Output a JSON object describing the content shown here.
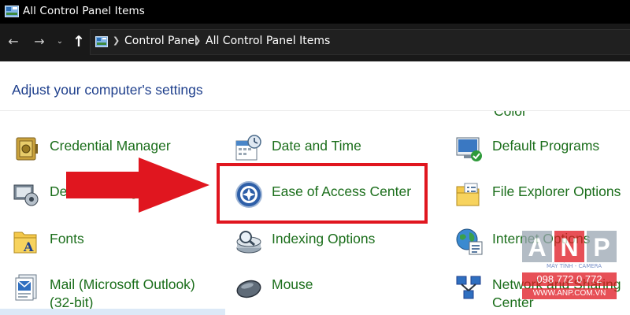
{
  "window": {
    "title": "All Control Panel Items",
    "app_icon": "control-panel-icon"
  },
  "address_bar": {
    "breadcrumbs": [
      "Control Panel",
      "All Control Panel Items"
    ]
  },
  "main": {
    "heading": "Adjust your computer's settings",
    "items": [
      {
        "label": "Credential Manager",
        "icon": "credential-manager-icon"
      },
      {
        "label": "Date and Time",
        "icon": "date-time-icon"
      },
      {
        "label": "Default Programs",
        "icon": "default-programs-icon"
      },
      {
        "label": "Device Manager",
        "icon": "device-manager-icon"
      },
      {
        "label": "Ease of Access Center",
        "icon": "ease-of-access-icon"
      },
      {
        "label": "File Explorer Options",
        "icon": "file-explorer-options-icon"
      },
      {
        "label": "Fonts",
        "icon": "fonts-icon"
      },
      {
        "label": "Indexing Options",
        "icon": "indexing-options-icon"
      },
      {
        "label": "Internet Options",
        "icon": "internet-options-icon"
      },
      {
        "label": "Mail (Microsoft Outlook)",
        "label_line2": "(32-bit)",
        "icon": "mail-icon"
      },
      {
        "label": "Mouse",
        "icon": "mouse-icon"
      },
      {
        "label": "Network and Sharing",
        "label_line2": "Center",
        "icon": "network-sharing-icon"
      }
    ],
    "clipped_top_item": "Color Management"
  },
  "annotation": {
    "highlight_color": "#e0161f",
    "arrow_color": "#e0161f"
  },
  "watermark": {
    "brand": "ANP",
    "tagline": "MÁY TÍNH - CAMERA",
    "phone": "098 772 0 772",
    "website": "WWW.ANP.COM.VN"
  },
  "colors": {
    "link_green": "#1b6e1b",
    "heading_blue": "#1e3f8c",
    "titlebar_bg": "#000000"
  }
}
